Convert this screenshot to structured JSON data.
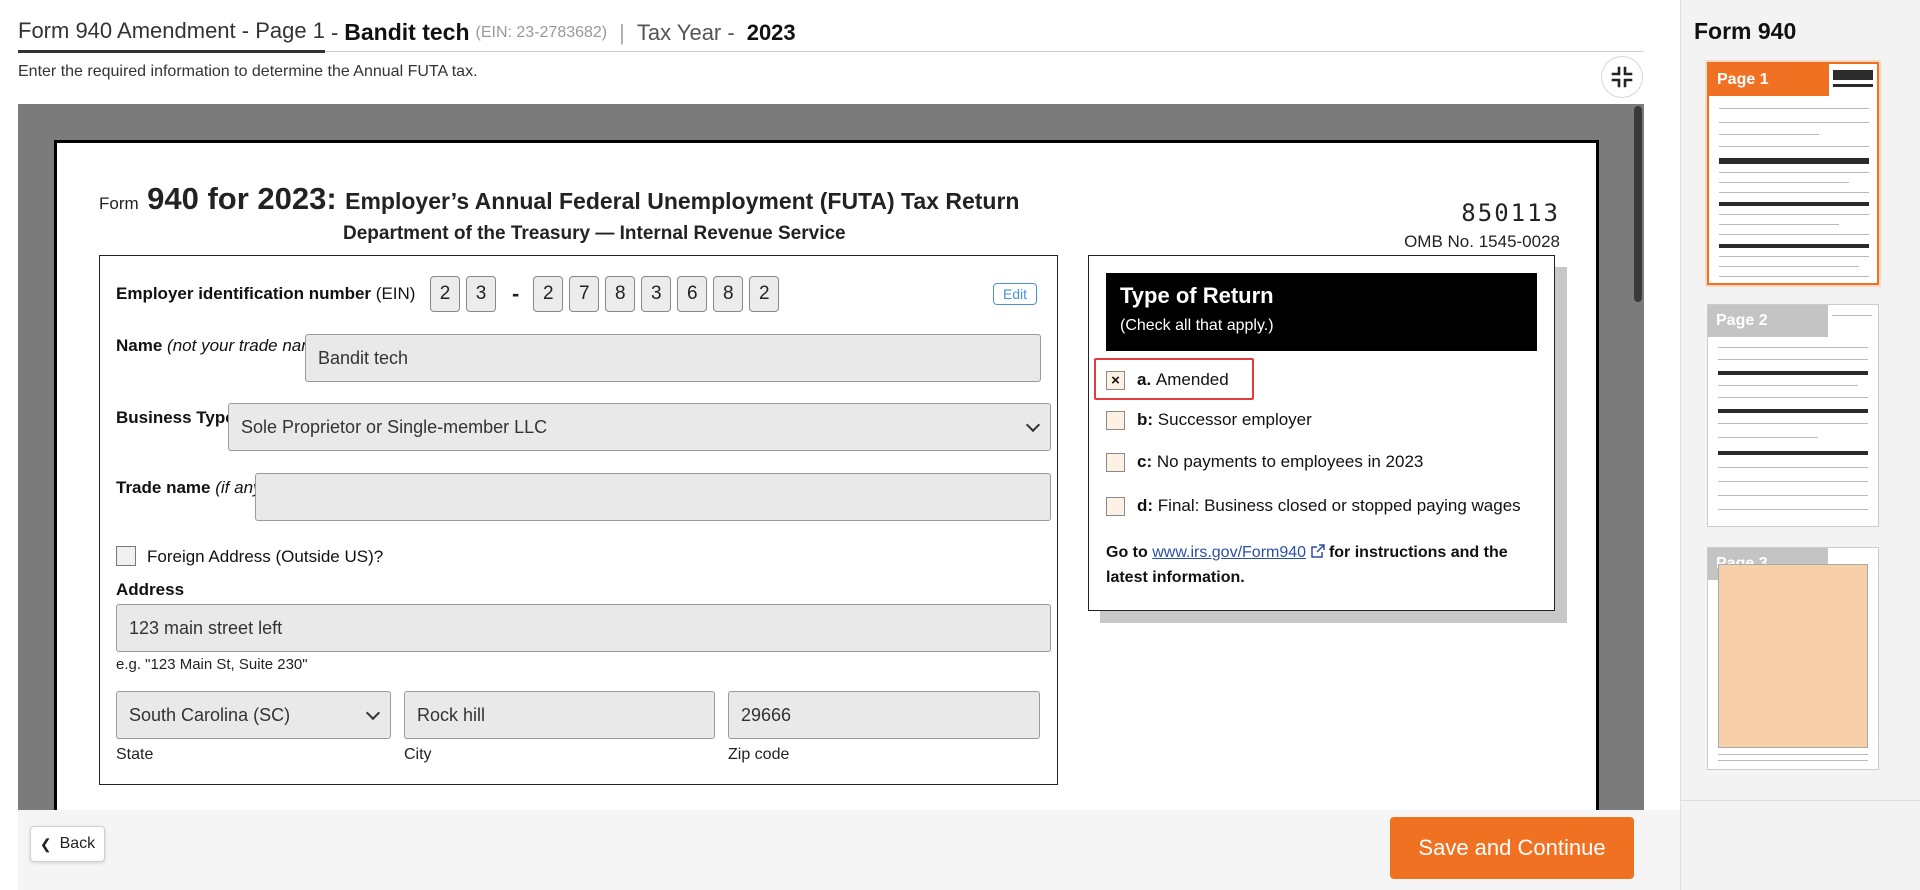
{
  "header": {
    "form_title": "Form 940 Amendment - Page 1",
    "separator": "-",
    "company": "Bandit tech",
    "ein": "(EIN: 23-2783682)",
    "pipe": "|",
    "tax_year_label": "Tax Year -",
    "tax_year": "2023"
  },
  "instruction": "Enter the required information to determine the Annual FUTA tax.",
  "form": {
    "form_word": "Form",
    "form_number": "940 for 2023:",
    "form_title": "Employer’s Annual Federal Unemployment (FUTA) Tax Return",
    "department": "Department of the Treasury — Internal Revenue Service",
    "code": "850113",
    "omb": "OMB No. 1545-0028",
    "ein_label": "Employer identification number",
    "ein_suffix": "(EIN)",
    "ein_digits_a": [
      "2",
      "3"
    ],
    "ein_dash": "-",
    "ein_digits_b": [
      "2",
      "7",
      "8",
      "3",
      "6",
      "8",
      "2"
    ],
    "edit_label": "Edit",
    "name_label": "Name",
    "name_note": "(not your trade name)",
    "name_value": "Bandit tech",
    "business_type_label": "Business Type",
    "business_type_value": "Sole Proprietor or Single-member LLC",
    "trade_name_label": "Trade name",
    "trade_name_note": "(if any)",
    "trade_name_value": "",
    "foreign_label": "Foreign Address (Outside US)?",
    "address_label": "Address",
    "address_value": "123 main street left",
    "address_hint": "e.g. \"123 Main St, Suite 230\"",
    "state_value": "South Carolina (SC)",
    "city_value": "Rock hill",
    "zip_value": "29666",
    "state_label": "State",
    "city_label": "City",
    "zip_label": "Zip code"
  },
  "type_of_return": {
    "title": "Type of Return",
    "subtitle": "(Check all that apply.)",
    "options": [
      {
        "key": "a.",
        "text": "Amended",
        "checked_mark": "×"
      },
      {
        "key": "b:",
        "text": "Successor employer",
        "checked_mark": ""
      },
      {
        "key": "c:",
        "text": "No payments to employees in 2023",
        "checked_mark": ""
      },
      {
        "key": "d:",
        "text": "Final: Business closed or stopped paying wages",
        "checked_mark": ""
      }
    ],
    "goto_prefix": "Go to",
    "goto_link": "www.irs.gov/Form940",
    "goto_suffix": "for instructions and the latest information."
  },
  "footer": {
    "back_label": "Back",
    "save_label": "Save and Continue"
  },
  "sidebar": {
    "title": "Form 940",
    "pages": [
      {
        "label": "Page 1",
        "active": true
      },
      {
        "label": "Page 2",
        "active": false
      },
      {
        "label": "Page 3",
        "active": false
      }
    ]
  },
  "colors": {
    "accent": "#f07122",
    "highlight": "#e23b3b",
    "link": "#2a4fa8",
    "viewer_bg": "#7b7b7b"
  },
  "icons": [
    "collapse-icon",
    "chevron-down-icon",
    "external-link-icon",
    "chevron-left-icon",
    "close-x-icon"
  ]
}
